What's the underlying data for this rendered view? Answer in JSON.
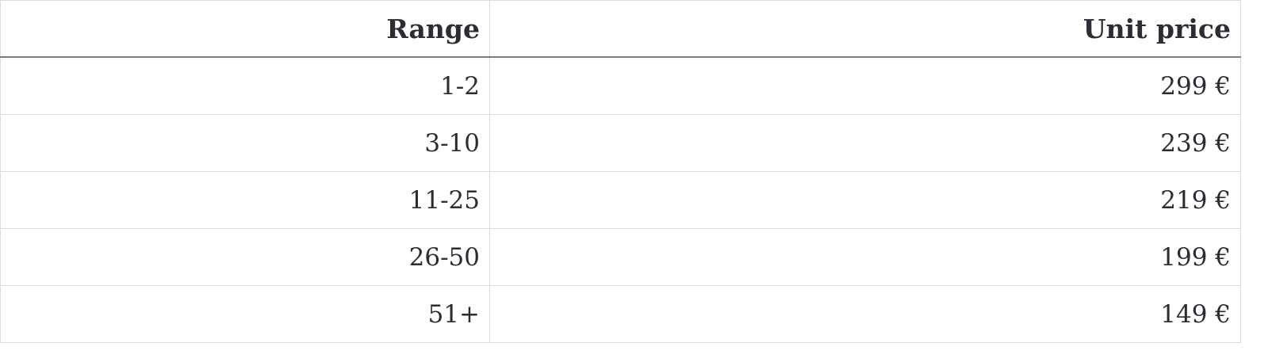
{
  "table": {
    "headers": {
      "range": "Range",
      "unit_price": "Unit price"
    },
    "rows": [
      {
        "range": "1-2",
        "unit_price": "299 €"
      },
      {
        "range": "3-10",
        "unit_price": "239 €"
      },
      {
        "range": "11-25",
        "unit_price": "219 €"
      },
      {
        "range": "26-50",
        "unit_price": "199 €"
      },
      {
        "range": "51+",
        "unit_price": "149 €"
      }
    ]
  }
}
